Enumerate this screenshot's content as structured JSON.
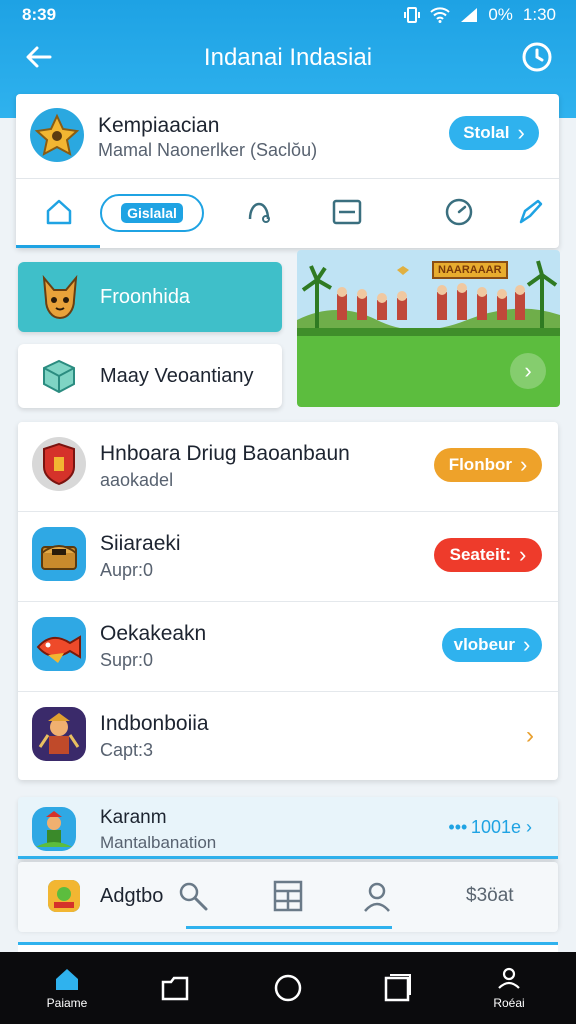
{
  "status_bar": {
    "time_left": "8:39",
    "battery": "0%",
    "time_right": "1:30"
  },
  "header": {
    "title": "Indanai Indasiai"
  },
  "top_card": {
    "title": "Kempiaacian",
    "subtitle": "Mamal Naonerlker (Saclŏu)",
    "button_label": "Stolal",
    "active_tab_label": "Gislalal"
  },
  "featured_button": {
    "label": "Froonhida"
  },
  "library_button": {
    "label": "Maay Veoantiany"
  },
  "banner": {
    "sign_text": "NAARAAAR"
  },
  "list": [
    {
      "title": "Hnboara Driug Baoanbaun",
      "subtitle": "aaokadel",
      "action": "Flonbor",
      "action_color": "#eea22a"
    },
    {
      "title": "Siiaraeki",
      "subtitle": "Aupr:0",
      "action": "Seateit:",
      "action_color": "#ee3b2b"
    },
    {
      "title": "Oekakeakn",
      "subtitle": "Supr:0",
      "action": "vlobeur",
      "action_color": "#2fb2ee"
    },
    {
      "title": "Indbonboiia",
      "subtitle": "Capt:3",
      "action": "",
      "action_color": ""
    }
  ],
  "promo": {
    "title": "Karanm",
    "subtitle": "Mantalbanation",
    "value": "••• 1001e"
  },
  "bottom_bar": {
    "item_label": "Adgtbo",
    "price": "$3öat"
  },
  "navbar": {
    "left_label": "Paiame",
    "right_label": "Roéai"
  },
  "colors": {
    "primary": "#1fa3e3",
    "teal": "#3fbfc9",
    "orange": "#eea22a",
    "red": "#ee3b2b"
  }
}
